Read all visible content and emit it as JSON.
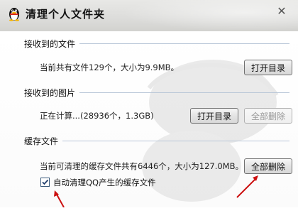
{
  "window": {
    "title": "清理个人文件夹"
  },
  "sections": {
    "received_files": {
      "title": "接收到的文件",
      "info": "当前共有文件129个，大小为9.9MB。",
      "open_button": "打开目录"
    },
    "received_images": {
      "title": "接收到的图片",
      "info": "正在计算...(28936个，1.3GB)",
      "open_button": "打开目录",
      "delete_all_button": "全部删除"
    },
    "cache_files": {
      "title": "缓存文件",
      "info": "当前可清理的缓存文件共有6446个，大小为127.0MB。",
      "delete_all_button": "全部删除",
      "auto_clean_label": "自动清理QQ产生的缓存文件",
      "auto_clean_checked": true
    }
  },
  "colors": {
    "annotation_arrow": "#cc1111"
  }
}
